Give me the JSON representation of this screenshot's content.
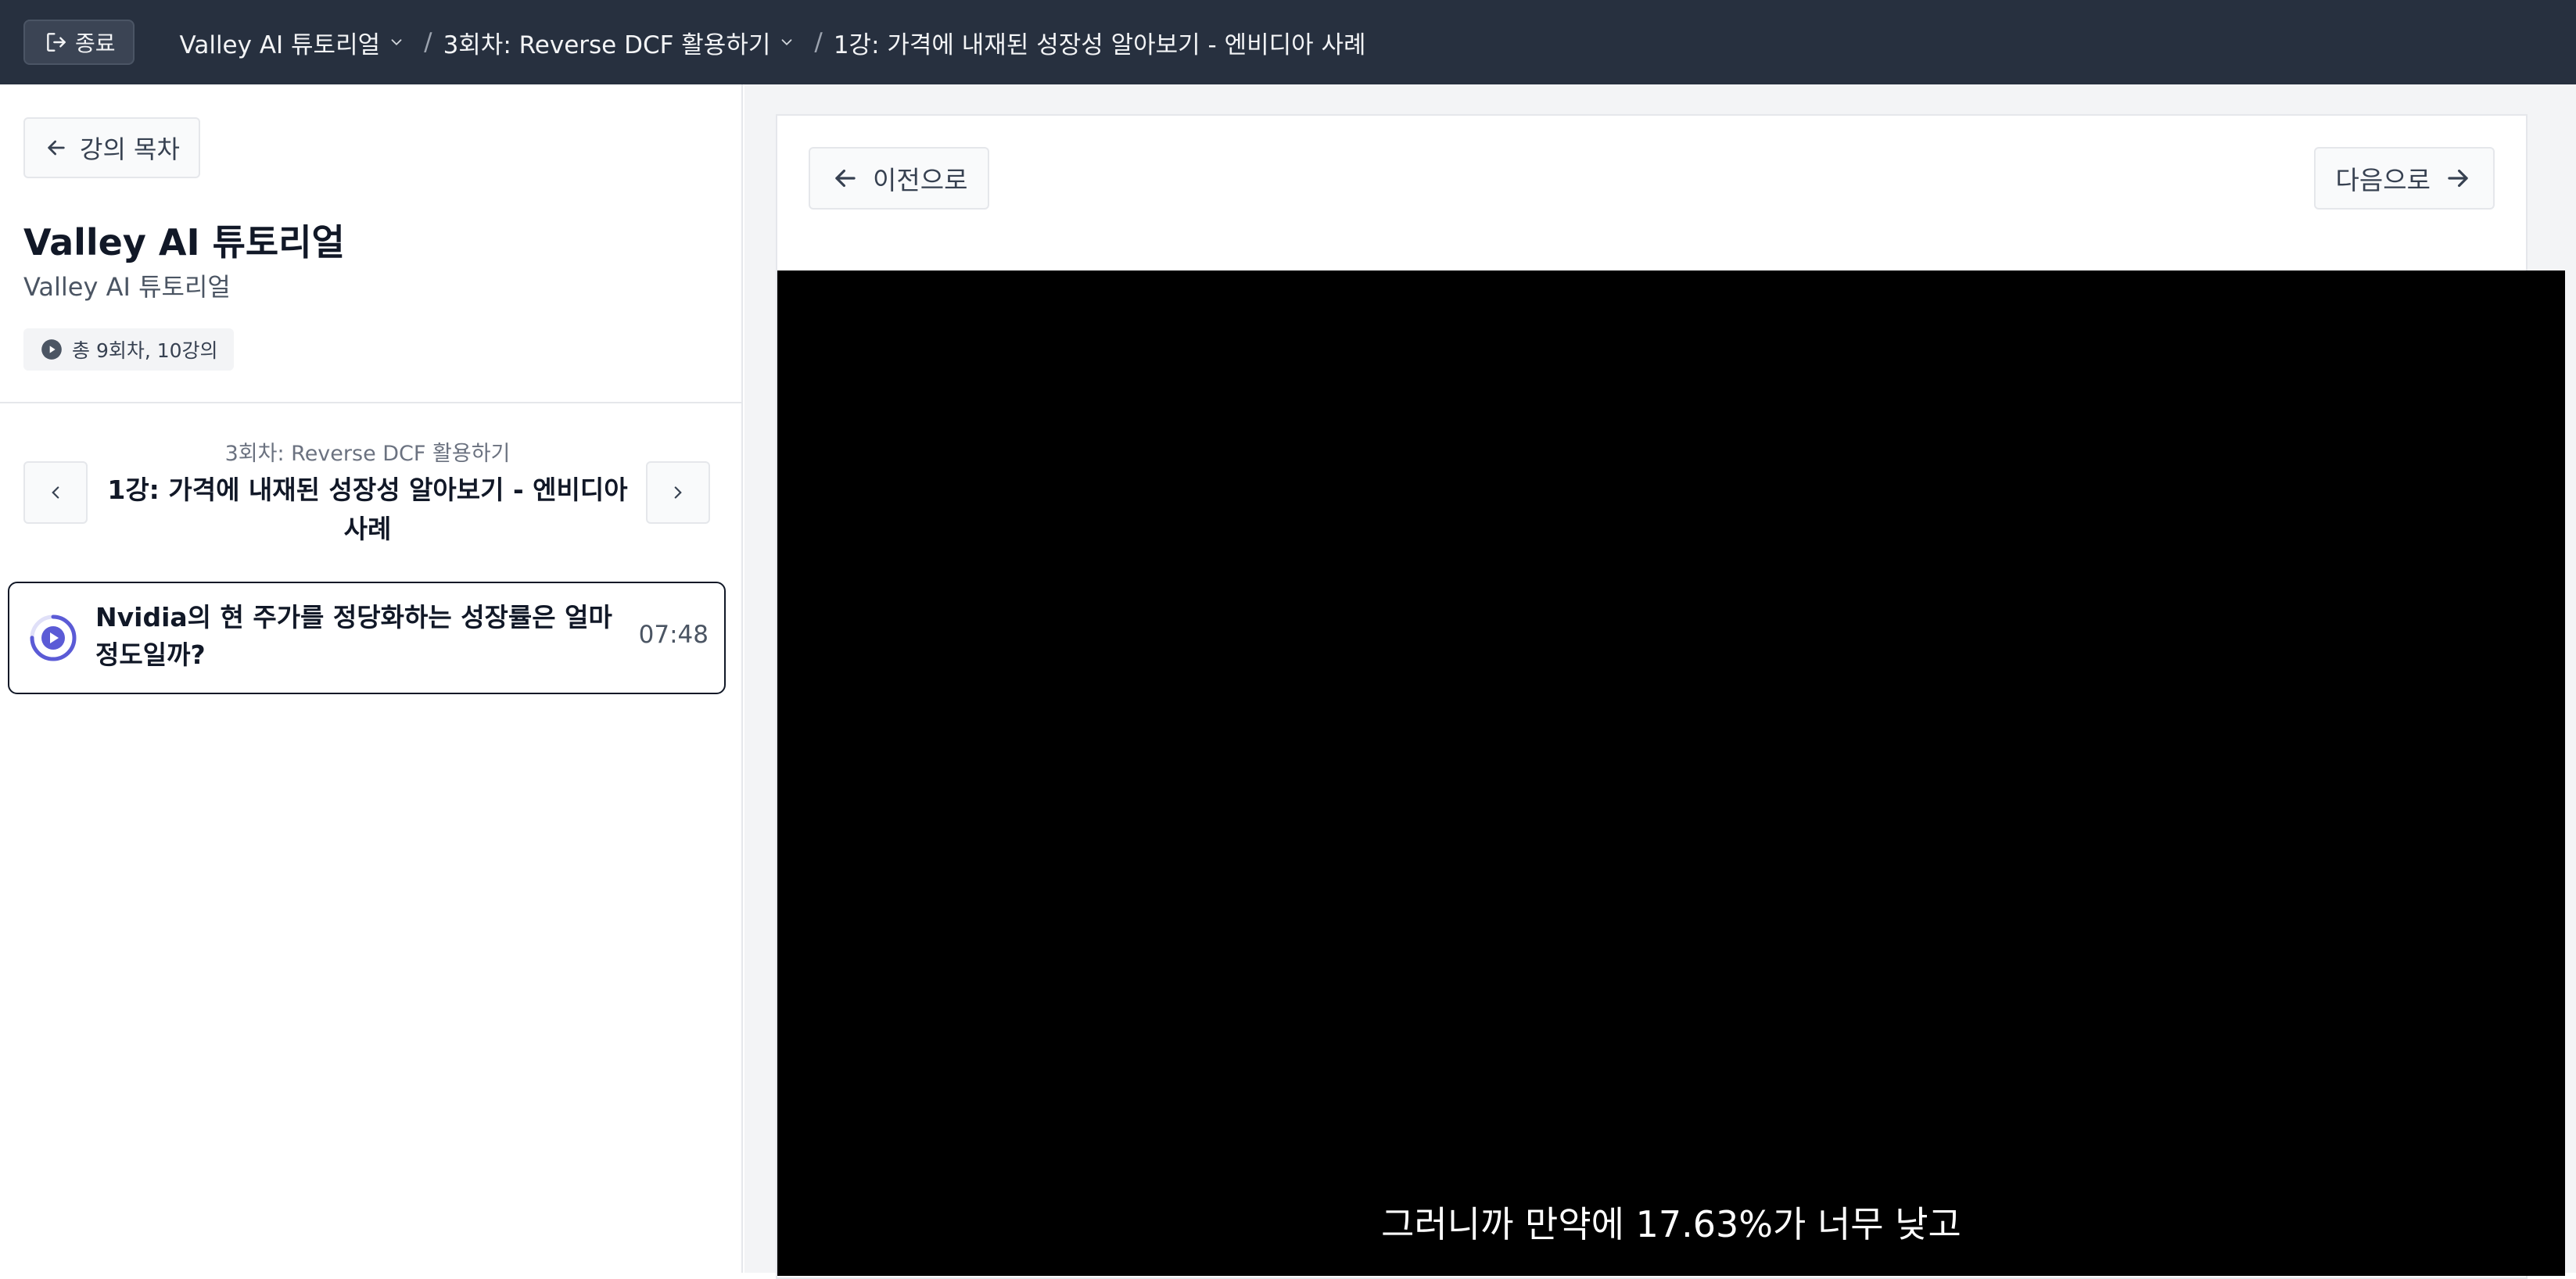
{
  "topbar": {
    "exit_label": "종료",
    "breadcrumbs": [
      {
        "label": "Valley AI 튜토리얼"
      },
      {
        "label": "3회차: Reverse DCF 활용하기"
      },
      {
        "label": "1강: 가격에 내재된 성장성 알아보기 - 엔비디아 사례"
      }
    ],
    "separator": "/"
  },
  "sidebar": {
    "toc_label": "강의 목차",
    "course_title": "Valley AI 튜토리얼",
    "course_subtitle": "Valley AI 튜토리얼",
    "count_badge": "총 9회차, 10강의",
    "lecture_nav": {
      "session": "3회차: Reverse DCF 활용하기",
      "title": "1강: 가격에 내재된 성장성 알아보기 - 엔비디아 사례"
    },
    "items": [
      {
        "title": "Nvidia의 현 주가를 정당화하는 성장률은 얼마 정도일까?",
        "duration": "07:48",
        "progress": 0.75
      }
    ]
  },
  "main": {
    "prev_label": "이전으로",
    "next_label": "다음으로",
    "video": {
      "caption": "그러니까 만약에 17.63%가 너무 낮고"
    }
  },
  "colors": {
    "topbar_bg": "#27303f",
    "accent": "#5b5bd6",
    "video_bg": "#000000"
  }
}
